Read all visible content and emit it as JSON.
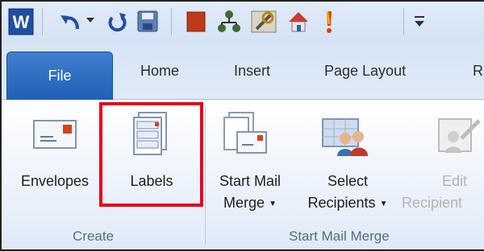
{
  "qat": {
    "icons": [
      "word-app-icon",
      "undo-icon",
      "undo-dropdown-icon",
      "redo-icon",
      "save-icon",
      "stop-icon",
      "org-chart-icon",
      "tools-icon",
      "home-macro-icon",
      "alert-icon",
      "customize-qat-icon"
    ]
  },
  "tabs": {
    "file": "File",
    "home": "Home",
    "insert": "Insert",
    "page_layout": "Page Layout",
    "overflow": "R"
  },
  "ribbon": {
    "envelopes": "Envelopes",
    "labels": "Labels",
    "start_mail_line1": "Start Mail",
    "start_mail_line2": "Merge",
    "select_line1": "Select",
    "select_line2": "Recipients",
    "edit_line1": "Edit",
    "edit_line2": "Recipient",
    "group_create": "Create",
    "group_start_mail_merge": "Start Mail Merge"
  },
  "colors": {
    "highlight": "#e8001c",
    "file_tab": "#2a6bc2"
  }
}
